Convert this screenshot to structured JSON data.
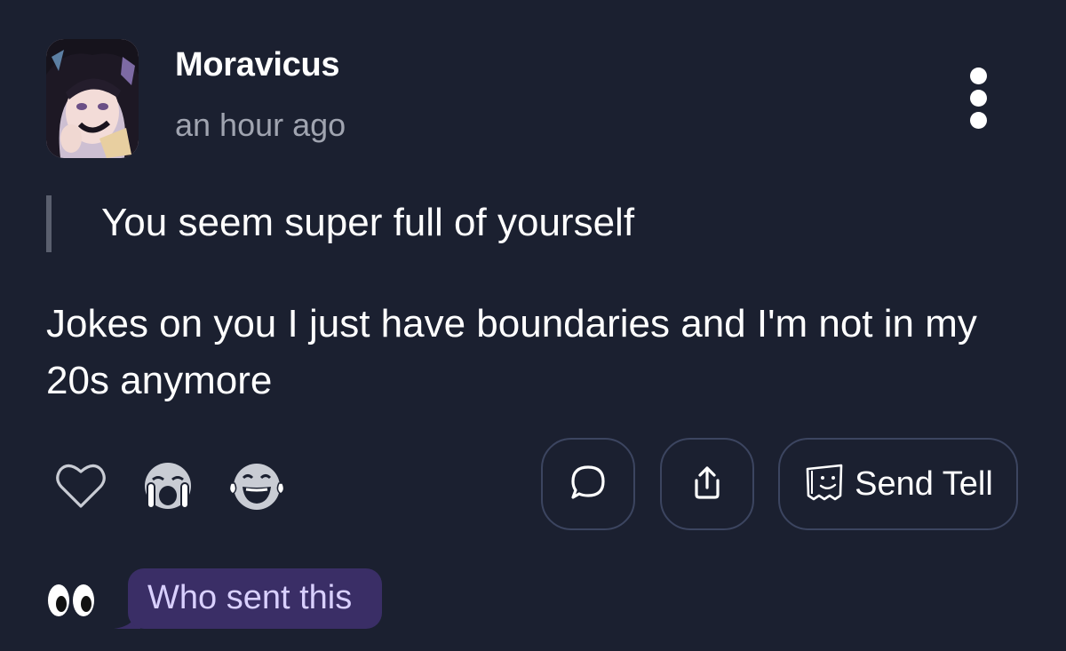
{
  "post": {
    "author": "Moravicus",
    "time": "an hour ago",
    "question": "You seem super full of yourself",
    "answer": "Jokes on you I just have boundaries and I'm not in my 20s anymore"
  },
  "actions": {
    "send_tell_label": "Send Tell",
    "reactions": [
      "heart-icon",
      "crying-face-icon",
      "laughing-face-icon"
    ],
    "buttons": [
      "comment-icon",
      "share-icon",
      "tell-icon"
    ]
  },
  "reveal": {
    "label": "Who sent this",
    "icon": "eyes-icon"
  },
  "colors": {
    "background": "#1b2030",
    "muted_text": "#a0a4b0",
    "button_border": "#3c4560",
    "bubble": "#3a2e66",
    "bubble_text": "#d9d0ff"
  }
}
